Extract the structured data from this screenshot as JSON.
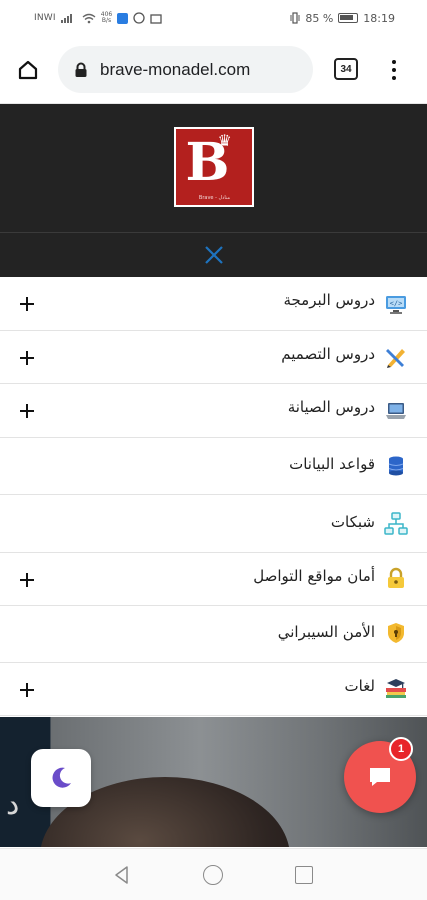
{
  "status_bar": {
    "carrier": "INWI",
    "speed_value": "406",
    "speed_unit": "B/s",
    "battery": "85 %",
    "time": "18:19"
  },
  "browser": {
    "url": "brave-monadel.com",
    "tab_count": "34"
  },
  "site": {
    "logo_letter": "B",
    "logo_tagline": "Brave - منادل"
  },
  "menu": {
    "items": [
      {
        "label": "دروس البرمجة",
        "icon": "programming-monitor-icon",
        "expandable": true
      },
      {
        "label": "دروس التصميم",
        "icon": "design-tools-icon",
        "expandable": true
      },
      {
        "label": "دروس الصيانة",
        "icon": "laptop-maintenance-icon",
        "expandable": true
      },
      {
        "label": "قواعد البيانات",
        "icon": "database-icon",
        "expandable": false
      },
      {
        "label": "شبكات",
        "icon": "network-icon",
        "expandable": false
      },
      {
        "label": "أمان مواقع التواصل",
        "icon": "padlock-icon",
        "expandable": true
      },
      {
        "label": "الأمن السيبراني",
        "icon": "cyber-shield-icon",
        "expandable": false
      },
      {
        "label": "لغات",
        "icon": "books-icon",
        "expandable": true
      }
    ]
  },
  "hero": {
    "glyph": "د"
  },
  "chat": {
    "badge_count": "1"
  },
  "colors": {
    "header_bg": "#232323",
    "close_icon": "#1e73be",
    "chat_button": "#f0524f",
    "darkmode_moon": "#6a4cc9"
  }
}
